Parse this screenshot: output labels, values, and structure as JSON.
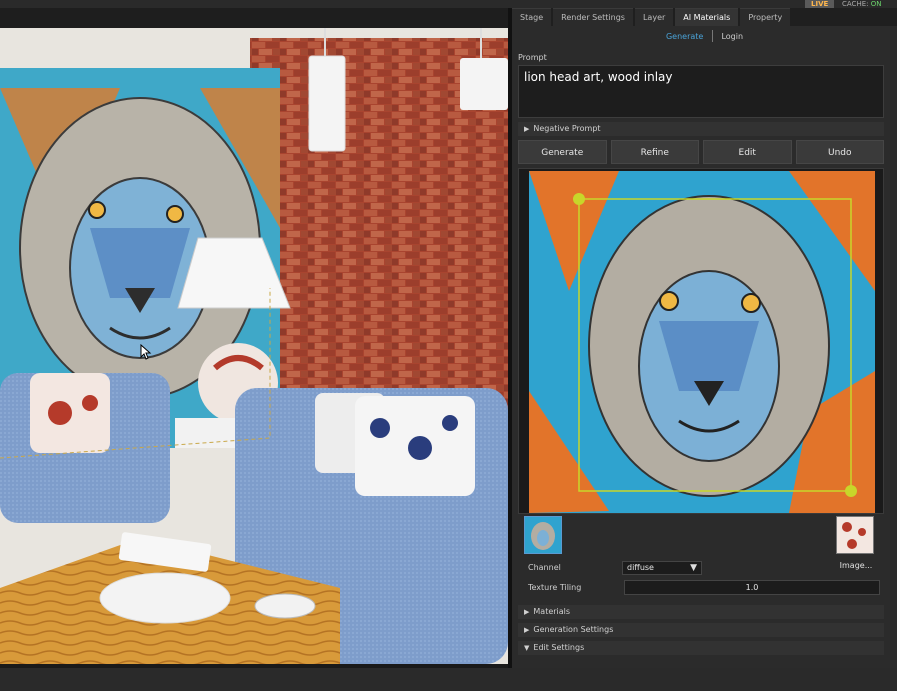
{
  "topbar": {
    "live_label": "LIVE",
    "cache_label": "CACHE:",
    "cache_state": "ON"
  },
  "tabs": [
    {
      "label": "Stage",
      "active": false
    },
    {
      "label": "Render Settings",
      "active": false
    },
    {
      "label": "Layer",
      "active": false
    },
    {
      "label": "AI Materials",
      "active": true
    },
    {
      "label": "Property",
      "active": false
    }
  ],
  "subtabs": {
    "generate": "Generate",
    "login": "Login"
  },
  "prompt": {
    "label": "Prompt",
    "value": "lion head art, wood inlay"
  },
  "sections": {
    "negative_prompt": "Negative Prompt",
    "materials": "Materials",
    "generation_settings": "Generation Settings",
    "edit_settings": "Edit Settings"
  },
  "buttons": {
    "generate": "Generate",
    "refine": "Refine",
    "edit": "Edit",
    "undo": "Undo"
  },
  "channel": {
    "label": "Channel",
    "value": "diffuse"
  },
  "texture_tiling": {
    "label": "Texture Tiling",
    "value": "1.0"
  },
  "image_button": "Image...",
  "colors": {
    "accent": "#4aa3d8",
    "crop_handle": "#c8d62a",
    "panel_bg": "#2b2b2b",
    "sofa": "#7b9ccc",
    "brick": "#b0503a"
  }
}
